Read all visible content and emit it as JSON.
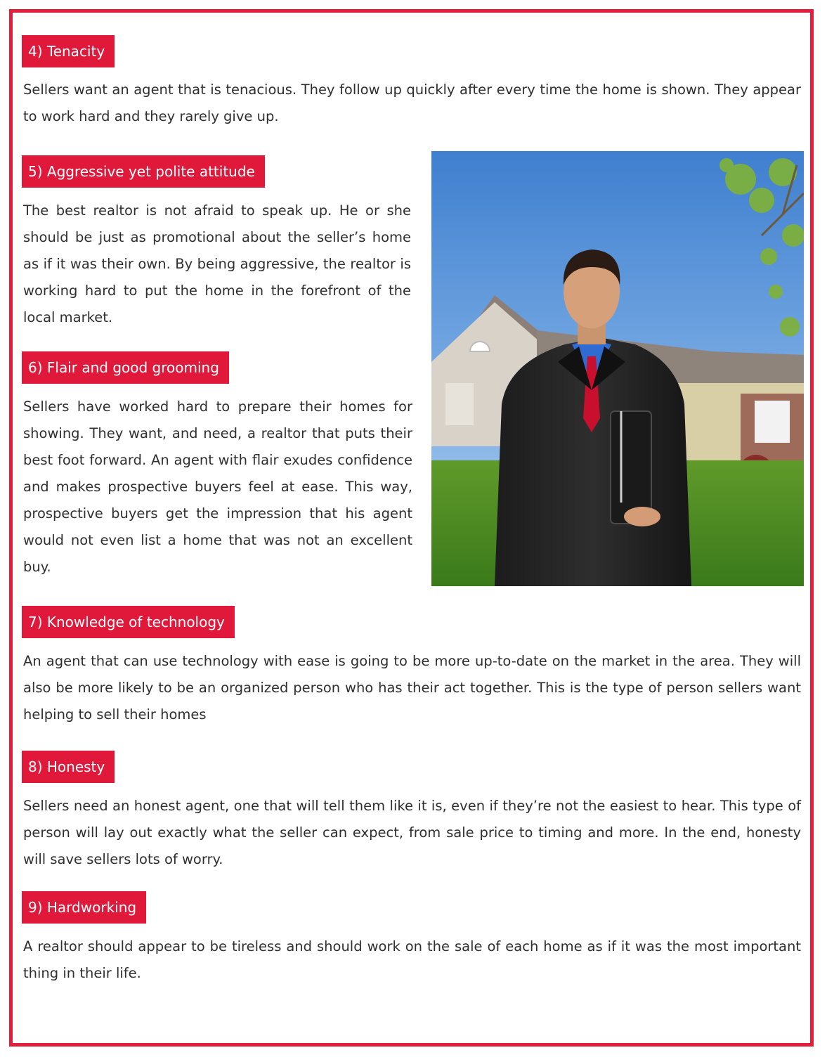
{
  "sections": [
    {
      "heading": "4)  Tenacity",
      "text": "Sellers want an agent that is tenacious. They follow up quickly after every time the home is shown. They appear to work hard and they rarely give up."
    },
    {
      "heading": "5)  Aggressive yet polite attitude",
      "text": "The best realtor is not afraid to speak up. He or she should be just as promotional about the seller’s home as if it was their own. By being aggressive, the realtor is working hard to put the home in the forefront of the local market."
    },
    {
      "heading": "6)  Flair and good grooming",
      "text": "Sellers have worked hard to prepare their homes for showing. They want, and need, a realtor that puts their best foot forward. An agent with flair exudes confidence and makes prospective buyers feel at ease. This way, prospective buyers get the impression that his agent would not even list a home that was not an excellent buy."
    },
    {
      "heading": "7)  Knowledge of technology",
      "text": "An agent that can use technology with ease is going to be more up-to-date on the market in the area. They will also be more likely to be an organized person who has their act together. This is the type of person sellers want helping to sell their homes"
    },
    {
      "heading": "8)  Honesty",
      "text": "Sellers need an honest agent, one that will tell them like it is, even if they’re not the easiest to hear. This type of person will lay out exactly what the seller can expect, from sale price to timing and more. In the end, honesty will save sellers lots of worry."
    },
    {
      "heading": "9)  Hardworking",
      "text": "A realtor should appear to be tireless and should work on the sale of each home as if it was the most important thing in their life."
    }
  ],
  "colors": {
    "accent": "#e0183a",
    "border": "#e21f3b",
    "text": "#2f2f2f"
  },
  "photo": {
    "subject": "realtor-in-suit-in-front-of-house-photo"
  }
}
